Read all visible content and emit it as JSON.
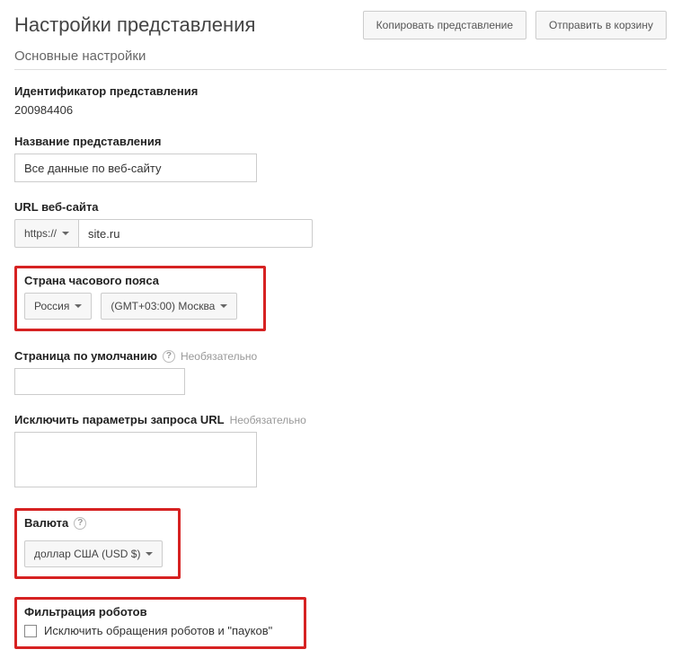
{
  "header": {
    "title": "Настройки представления",
    "copy_button": "Копировать представление",
    "trash_button": "Отправить в корзину"
  },
  "section_heading": "Основные настройки",
  "view_id": {
    "label": "Идентификатор представления",
    "value": "200984406"
  },
  "view_name": {
    "label": "Название представления",
    "value": "Все данные по веб-сайту"
  },
  "website_url": {
    "label": "URL веб-сайта",
    "protocol": "https://",
    "host": "site.ru"
  },
  "timezone": {
    "label": "Страна часового пояса",
    "country": "Россия",
    "tz": "(GMT+03:00) Москва"
  },
  "default_page": {
    "label": "Страница по умолчанию",
    "optional": "Необязательно",
    "value": ""
  },
  "exclude_params": {
    "label": "Исключить параметры запроса URL",
    "optional": "Необязательно",
    "value": ""
  },
  "currency": {
    "label": "Валюта",
    "value": "доллар США (USD $)"
  },
  "robots": {
    "label": "Фильтрация роботов",
    "checkbox_label": "Исключить обращения роботов и \"пауков\"",
    "checked": false
  }
}
